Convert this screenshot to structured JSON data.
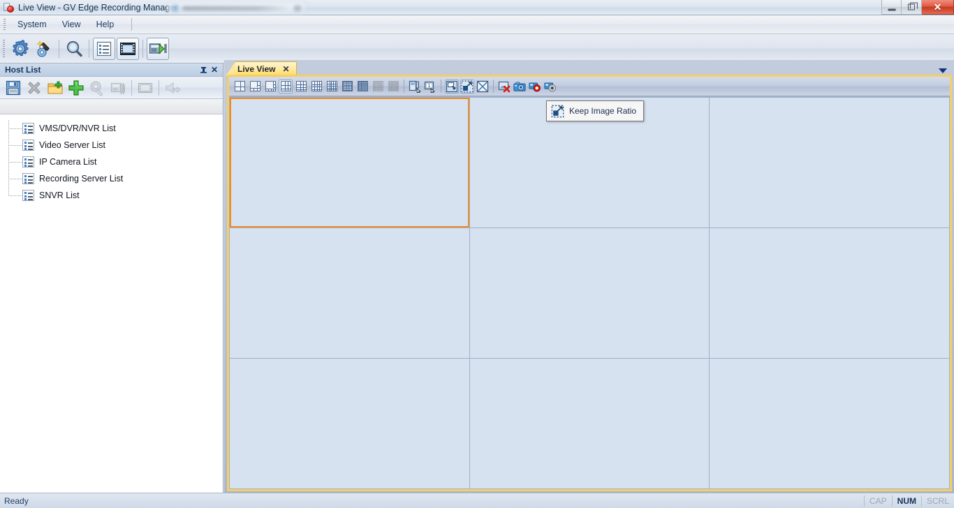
{
  "window": {
    "title": "Live View - GV Edge Recording Manager",
    "app_icon": "recorder-icon",
    "minimize_label": "Minimize",
    "restore_label": "Restore",
    "close_label": "Close",
    "close_glyph": "✕"
  },
  "menubar": {
    "items": [
      {
        "label": "System"
      },
      {
        "label": "View"
      },
      {
        "label": "Help"
      }
    ]
  },
  "main_toolbar": {
    "buttons": [
      {
        "name": "system-configure-button",
        "icon": "gear-icon",
        "tooltip": "System Configure"
      },
      {
        "name": "magic-wizard-button",
        "icon": "magic-wand-icon",
        "tooltip": "Wizard"
      },
      {
        "name": "search-button",
        "icon": "magnifier-icon",
        "tooltip": "Search"
      },
      {
        "name": "host-list-button",
        "icon": "list-icon",
        "tooltip": "Host List"
      },
      {
        "name": "video-button",
        "icon": "film-icon",
        "tooltip": "Video"
      },
      {
        "name": "playback-button",
        "icon": "playback-icon",
        "tooltip": "Playback"
      }
    ]
  },
  "host_panel": {
    "title": "Host List",
    "pin_glyph": "⊥",
    "close_glyph": "✕",
    "toolbar": [
      {
        "name": "save-button",
        "icon": "floppy-save-icon",
        "tooltip": "Save"
      },
      {
        "name": "delete-button",
        "icon": "delete-x-icon",
        "tooltip": "Delete"
      },
      {
        "name": "new-folder-button",
        "icon": "new-folder-icon",
        "tooltip": "New Folder"
      },
      {
        "name": "add-host-button",
        "icon": "plus-icon",
        "tooltip": "Add Host"
      },
      {
        "name": "settings-button",
        "icon": "gear-wrench-icon",
        "tooltip": "Settings"
      },
      {
        "name": "copy-host-button",
        "icon": "copy-icon",
        "tooltip": "Copy"
      },
      {
        "name": "filmstrip-button",
        "icon": "filmstrip-icon",
        "tooltip": "Video"
      },
      {
        "name": "import-button",
        "icon": "import-arrow-icon",
        "tooltip": "Import"
      }
    ],
    "tree": [
      {
        "label": "VMS/DVR/NVR List",
        "icon": "list-icon"
      },
      {
        "label": "Video Server List",
        "icon": "list-icon"
      },
      {
        "label": "IP Camera List",
        "icon": "list-icon"
      },
      {
        "label": "Recording Server List",
        "icon": "list-icon"
      },
      {
        "label": "SNVR List",
        "icon": "list-icon"
      }
    ]
  },
  "document_area": {
    "tab": {
      "label": "Live View",
      "close_glyph": "✕"
    },
    "tab_overflow_icon": "chevron-down-icon"
  },
  "live_toolbar": {
    "layouts": [
      {
        "name": "layout-1x1-button",
        "cols": 2,
        "rows": 2,
        "dim": false,
        "style": "quad"
      },
      {
        "name": "layout-pip-button",
        "cols": 3,
        "rows": 3,
        "dim": false,
        "style": "pip"
      },
      {
        "name": "layout-sidebar-button",
        "cols": 4,
        "rows": 4,
        "dim": false,
        "style": "side"
      },
      {
        "name": "layout-3x3-button",
        "cols": 3,
        "rows": 3,
        "dim": false,
        "style": "grid",
        "selected": true
      },
      {
        "name": "layout-3x4-button",
        "cols": 3,
        "rows": 4,
        "dim": false,
        "style": "grid"
      },
      {
        "name": "layout-4x4-button",
        "cols": 4,
        "rows": 4,
        "dim": false,
        "style": "grid"
      },
      {
        "name": "layout-5x5-button",
        "cols": 5,
        "rows": 5,
        "dim": false,
        "style": "grid"
      },
      {
        "name": "layout-6x6-button",
        "cols": 6,
        "rows": 6,
        "dim": false,
        "style": "grid"
      },
      {
        "name": "layout-8x8-button",
        "cols": 8,
        "rows": 8,
        "dim": false,
        "style": "grid"
      },
      {
        "name": "layout-10x10-button",
        "cols": 10,
        "rows": 10,
        "dim": true,
        "style": "grid"
      },
      {
        "name": "layout-12x12-button",
        "cols": 12,
        "rows": 12,
        "dim": true,
        "style": "grid"
      }
    ],
    "actions": [
      {
        "name": "camera-select-button",
        "icon": "camera-select-icon",
        "tooltip": "Camera Select"
      },
      {
        "name": "channel-name-button",
        "icon": "channel-name-icon",
        "tooltip": "Channel Name"
      },
      {
        "name": "fit-window-button",
        "icon": "fit-window-icon",
        "tooltip": "Fit to Window",
        "selected": true
      },
      {
        "name": "keep-image-ratio-button",
        "icon": "keep-image-ratio-icon",
        "tooltip": "Keep Image Ratio",
        "selected": true
      },
      {
        "name": "full-screen-button",
        "icon": "fullscreen-icon",
        "tooltip": "Full Screen"
      },
      {
        "name": "close-all-button",
        "icon": "close-all-video-icon",
        "tooltip": "Close All"
      },
      {
        "name": "snapshot-button",
        "icon": "camera-snapshot-icon",
        "tooltip": "Snapshot"
      },
      {
        "name": "record-start-button",
        "icon": "record-red-icon",
        "tooltip": "Start Recording"
      },
      {
        "name": "record-stop-button",
        "icon": "record-stop-icon",
        "tooltip": "Stop Recording"
      }
    ]
  },
  "tooltip": {
    "text": "Keep Image Ratio",
    "icon": "keep-image-ratio-icon"
  },
  "video_grid": {
    "rows": 3,
    "cols": 3,
    "cells": [
      {
        "name": "video-cell-1",
        "active": true
      },
      {
        "name": "video-cell-2",
        "active": false
      },
      {
        "name": "video-cell-3",
        "active": false
      },
      {
        "name": "video-cell-4",
        "active": false
      },
      {
        "name": "video-cell-5",
        "active": false
      },
      {
        "name": "video-cell-6",
        "active": false
      },
      {
        "name": "video-cell-7",
        "active": false
      },
      {
        "name": "video-cell-8",
        "active": false
      },
      {
        "name": "video-cell-9",
        "active": false
      }
    ]
  },
  "statusbar": {
    "message": "Ready",
    "indicators": [
      {
        "label": "CAP",
        "active": false
      },
      {
        "label": "NUM",
        "active": true
      },
      {
        "label": "SCRL",
        "active": false
      }
    ]
  },
  "colors": {
    "accent_orange": "#ef8b23",
    "tab_yellow": "#ffd95e",
    "frame_gold": "#f6cf63",
    "video_cell": "#d7e2f0",
    "grid_line": "#9fb0c9",
    "title_blue": "#17334d"
  }
}
